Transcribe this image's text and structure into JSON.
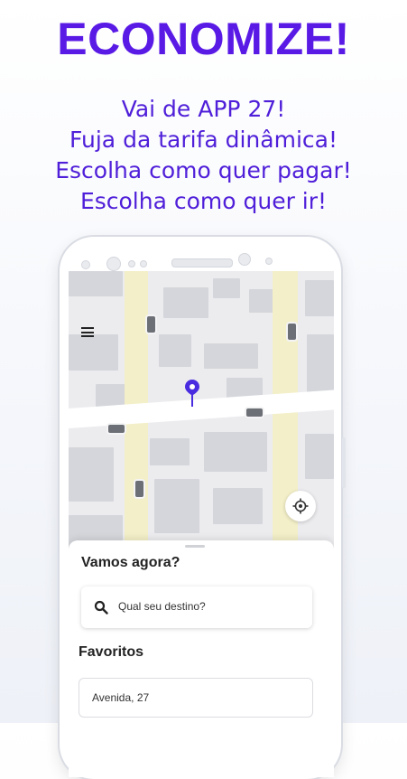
{
  "headline": "ECONOMIZE!",
  "taglines": [
    "Vai de APP 27!",
    "Fuja da tarifa dinâmica!",
    "Escolha como quer pagar!",
    "Escolha como quer ir!"
  ],
  "app": {
    "sheet": {
      "title": "Vamos agora?",
      "search_placeholder": "Qual seu destino?",
      "favorites_title": "Favoritos",
      "favorites": [
        "Avenida, 27"
      ]
    }
  },
  "colors": {
    "brand": "#5a1ae6",
    "pin": "#4a2ce0",
    "road_yellow": "#f3efc8"
  },
  "icons": [
    "menu-icon",
    "location-pin-icon",
    "crosshair-icon",
    "search-icon"
  ]
}
